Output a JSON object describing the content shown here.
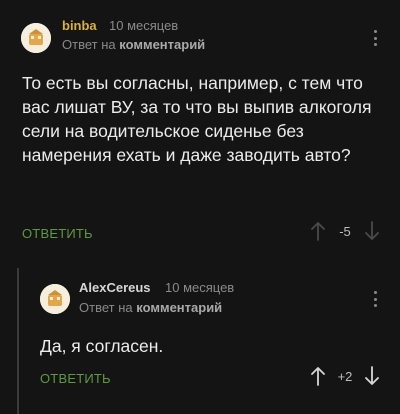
{
  "comments": [
    {
      "username": "binba",
      "time": "10 месяцев",
      "reply_prefix": "Ответ на",
      "reply_target": "комментарий",
      "text": "То есть вы согласны, например, с тем что вас лишат ВУ, за то что вы выпив алкоголя сели на водительское сиденье без намерения ехать и даже заводить авто?",
      "reply_label": "ОТВЕТИТЬ",
      "score": "-5",
      "username_color": "#d8b23a"
    },
    {
      "username": "AlexCereus",
      "time": "10 месяцев",
      "reply_prefix": "Ответ на",
      "reply_target": "комментарий",
      "text": "Да, я согласен.",
      "reply_label": "ОТВЕТИТЬ",
      "score": "+2",
      "username_color": "#d6d6d6"
    }
  ],
  "colors": {
    "background": "#141414",
    "accent_green": "#5d9a3e",
    "muted": "#8a8a8a"
  },
  "icons": {
    "avatar": "default-avatar-icon",
    "menu": "kebab-menu-icon",
    "upvote": "arrow-up-icon",
    "downvote": "arrow-down-icon"
  }
}
